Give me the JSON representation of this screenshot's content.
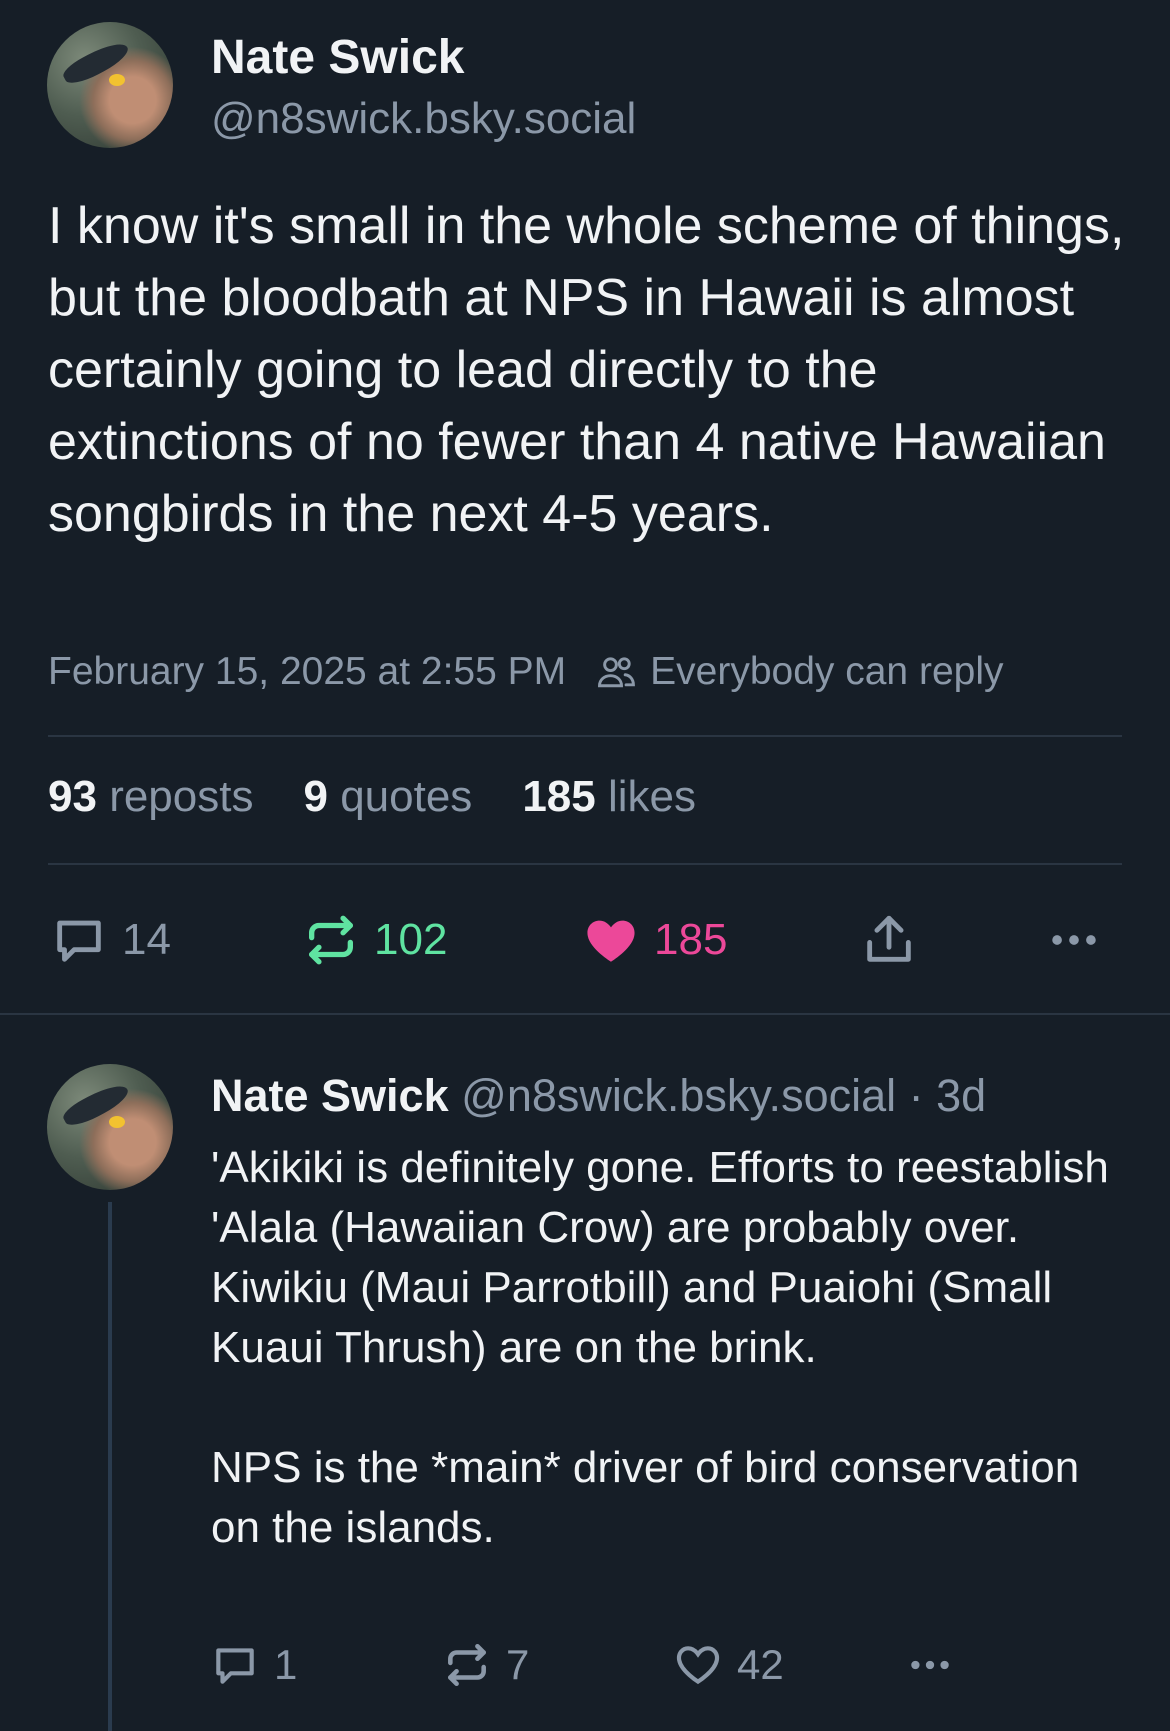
{
  "post": {
    "author_name": "Nate Swick",
    "author_handle": "@n8swick.bsky.social",
    "text": "I know it's small in the whole scheme of things, but the bloodbath at NPS in Hawaii is almost certainly going to lead directly to the extinctions of no fewer than 4 native Hawaiian songbirds in the next 4-5 years.",
    "timestamp": "February 15, 2025 at 2:55 PM",
    "reply_setting": "Everybody can reply",
    "stats": {
      "reposts_count": "93",
      "reposts_label": "reposts",
      "quotes_count": "9",
      "quotes_label": "quotes",
      "likes_count": "185",
      "likes_label": "likes"
    },
    "actions": {
      "replies": "14",
      "reposts": "102",
      "likes": "185"
    }
  },
  "reply": {
    "author_name": "Nate Swick",
    "author_handle": "@n8swick.bsky.social",
    "separator": "·",
    "time": "3d",
    "text": "'Akikiki is definitely gone. Efforts to reestablish 'Alala (Hawaiian Crow) are probably over. Kiwikiu (Maui Parrotbill) and Puaiohi (Small Kuaui Thrush) are on the brink.\n\nNPS is the *main* driver of bird conservation on the islands.",
    "actions": {
      "replies": "1",
      "reposts": "7",
      "likes": "42"
    }
  },
  "colors": {
    "background": "#161e27",
    "text_primary": "#f1f3f5",
    "text_secondary": "#8b98a8",
    "repost_active": "#5fe3a1",
    "like_active": "#ec4899",
    "divider": "#2a3542"
  },
  "icons": [
    "avatar",
    "people-icon",
    "comment-icon",
    "repost-icon",
    "heart-icon",
    "share-icon",
    "more-icon"
  ]
}
